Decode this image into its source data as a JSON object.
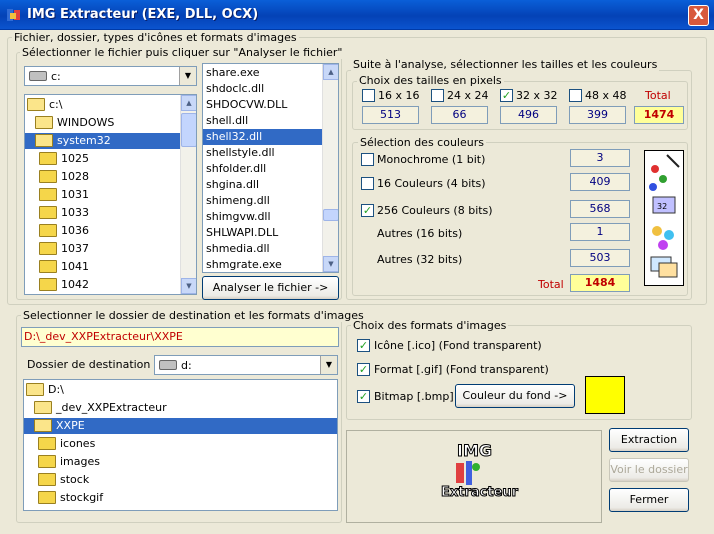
{
  "window": {
    "title": "IMG Extracteur (EXE, DLL, OCX)",
    "close_label": "X"
  },
  "source_group": {
    "label": "Fichier, dossier, types d'icônes et formats d'images",
    "select_label": "Sélectionner le fichier puis cliquer sur \"Analyser le fichier\"",
    "drive": "c:",
    "folders": [
      {
        "name": "c:\\",
        "selected": false
      },
      {
        "name": "WINDOWS",
        "selected": false
      },
      {
        "name": "system32",
        "selected": true
      },
      {
        "name": "1025",
        "selected": false
      },
      {
        "name": "1028",
        "selected": false
      },
      {
        "name": "1031",
        "selected": false
      },
      {
        "name": "1033",
        "selected": false
      },
      {
        "name": "1036",
        "selected": false
      },
      {
        "name": "1037",
        "selected": false
      },
      {
        "name": "1041",
        "selected": false
      },
      {
        "name": "1042",
        "selected": false
      }
    ],
    "files": [
      {
        "name": "share.exe",
        "selected": false
      },
      {
        "name": "shdoclc.dll",
        "selected": false
      },
      {
        "name": "SHDOCVW.DLL",
        "selected": false
      },
      {
        "name": "shell.dll",
        "selected": false
      },
      {
        "name": "shell32.dll",
        "selected": true
      },
      {
        "name": "shellstyle.dll",
        "selected": false
      },
      {
        "name": "shfolder.dll",
        "selected": false
      },
      {
        "name": "shgina.dll",
        "selected": false
      },
      {
        "name": "shimeng.dll",
        "selected": false
      },
      {
        "name": "shimgvw.dll",
        "selected": false
      },
      {
        "name": "SHLWAPI.DLL",
        "selected": false
      },
      {
        "name": "shmedia.dll",
        "selected": false
      },
      {
        "name": "shmgrate.exe",
        "selected": false
      }
    ],
    "analyze_button": "Analyser le fichier ->"
  },
  "analysis_group": {
    "label": "Suite à l'analyse, sélectionner les tailles et les couleurs",
    "sizes_label": "Choix des tailles en pixels",
    "sizes": [
      {
        "label": "16 x 16",
        "checked": false,
        "value": "513"
      },
      {
        "label": "24 x 24",
        "checked": false,
        "value": "66"
      },
      {
        "label": "32 x 32",
        "checked": true,
        "value": "496"
      },
      {
        "label": "48 x 48",
        "checked": false,
        "value": "399"
      }
    ],
    "sizes_total_label": "Total",
    "sizes_total": "1474",
    "colors_label": "Sélection des couleurs",
    "colors": [
      {
        "label": "Monochrome (1 bit)",
        "checked": false,
        "value": "3"
      },
      {
        "label": "16 Couleurs (4 bits)",
        "checked": false,
        "value": "409"
      },
      {
        "label": "256 Couleurs (8 bits)",
        "checked": true,
        "value": "568"
      },
      {
        "label": "Autres (16 bits)",
        "value": "1"
      },
      {
        "label": "Autres (32 bits)",
        "value": "503"
      }
    ],
    "colors_total_label": "Total",
    "colors_total": "1484"
  },
  "dest_group": {
    "label": "Selectionner le dossier de destination et les formats d'images",
    "path": "D:\\_dev_XXPExtracteur\\XXPE",
    "dest_label": "Dossier de destination :",
    "drive": "d:",
    "folders": [
      {
        "name": "D:\\",
        "selected": false
      },
      {
        "name": "_dev_XXPExtracteur",
        "selected": false
      },
      {
        "name": "XXPE",
        "selected": true
      },
      {
        "name": "icones",
        "selected": false
      },
      {
        "name": "images",
        "selected": false
      },
      {
        "name": "stock",
        "selected": false
      },
      {
        "name": "stockgif",
        "selected": false
      }
    ]
  },
  "formats_group": {
    "label": "Choix des formats d'images",
    "formats": [
      {
        "label": "Icône [.ico] (Fond transparent)",
        "checked": true
      },
      {
        "label": "Format [.gif] (Fond transparent)",
        "checked": true
      },
      {
        "label": "Bitmap [.bmp]",
        "checked": true
      }
    ],
    "bg_button": "Couleur du fond ->",
    "bg_color": "#FFFF00"
  },
  "logo": {
    "line1": "IMG",
    "line2": "Extracteur"
  },
  "actions": {
    "extract": "Extraction",
    "view_folder": "Voir le dossier",
    "close": "Fermer"
  },
  "colors": {
    "title_blue": "#0A5FD8",
    "selection": "#316AC5",
    "total_red": "#C00000",
    "value_navy": "#000080"
  }
}
